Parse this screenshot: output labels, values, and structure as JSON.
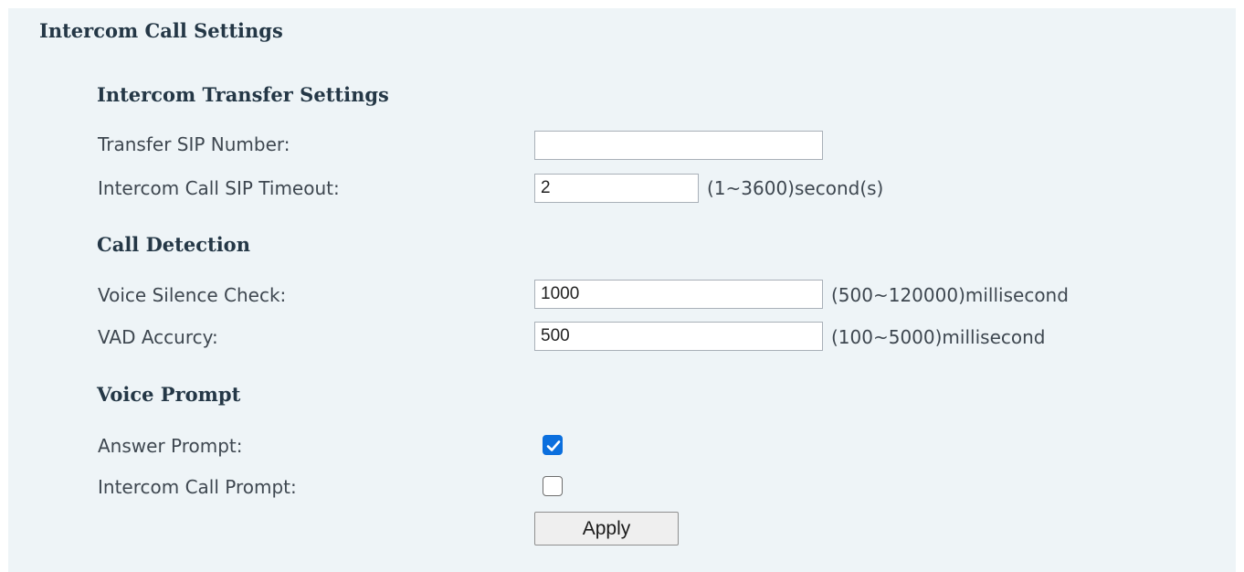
{
  "page": {
    "title": "Intercom Call Settings"
  },
  "intercom_transfer": {
    "title": "Intercom Transfer Settings",
    "transfer_sip_number": {
      "label": "Transfer SIP Number:",
      "value": ""
    },
    "sip_timeout": {
      "label": "Intercom Call SIP Timeout:",
      "value": "2",
      "hint": "(1~3600)second(s)"
    }
  },
  "call_detection": {
    "title": "Call Detection",
    "voice_silence_check": {
      "label": "Voice Silence Check:",
      "value": "1000",
      "hint": "(500~120000)millisecond"
    },
    "vad_accuracy": {
      "label": "VAD Accurcy:",
      "value": "500",
      "hint": "(100~5000)millisecond"
    }
  },
  "voice_prompt": {
    "title": "Voice Prompt",
    "answer_prompt": {
      "label": "Answer Prompt:",
      "checked": true
    },
    "intercom_call_prompt": {
      "label": "Intercom Call Prompt:",
      "checked": false
    }
  },
  "actions": {
    "apply_label": "Apply"
  },
  "colors": {
    "panel_background": "#eef4f7",
    "checkbox_accent": "#0b6fde",
    "heading_text": "#243746"
  },
  "icons": {
    "checked": "checkmark-icon"
  }
}
